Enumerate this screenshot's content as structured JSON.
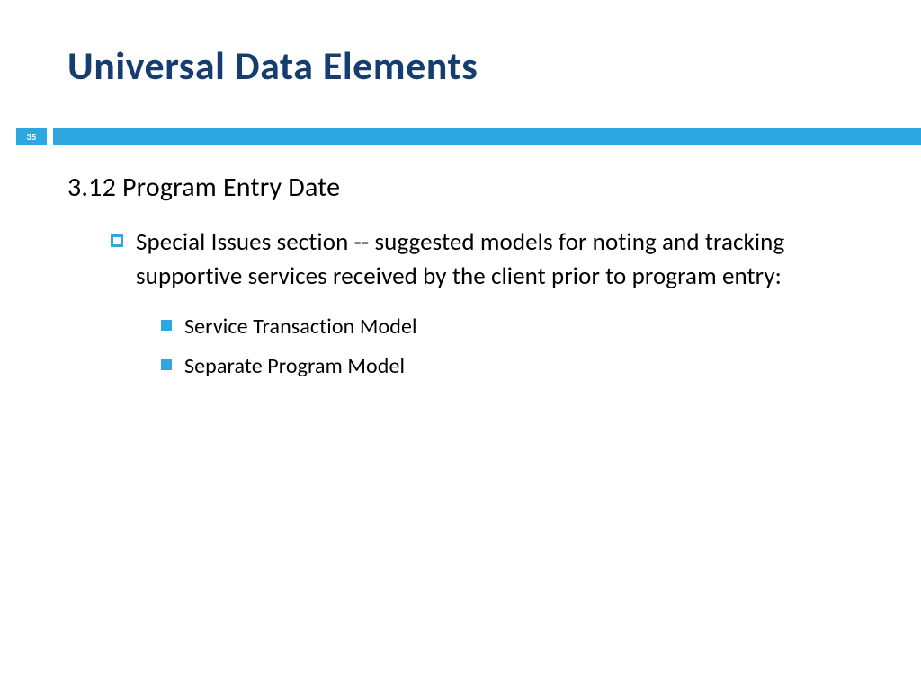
{
  "title": "Universal Data Elements",
  "page_number": "35",
  "section_heading": "3.12 Program Entry Date",
  "level1_item": "Special Issues section -- suggested models for noting and tracking supportive services received by the client prior to program entry:",
  "level2_items": [
    "Service Transaction Model",
    "Separate Program Model"
  ],
  "colors": {
    "title_color": "#163d6f",
    "accent_color": "#2ea7e0"
  }
}
